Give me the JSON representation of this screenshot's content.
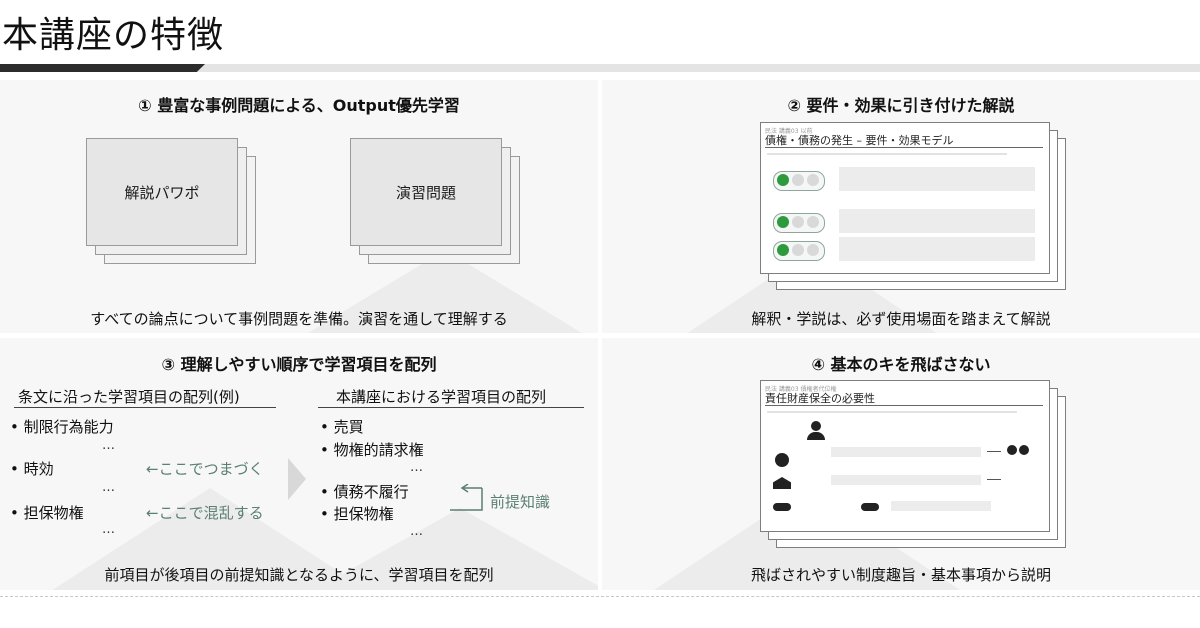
{
  "page": {
    "title": "本講座の特徴"
  },
  "q1": {
    "heading": "① 豊富な事例問題による、Output優先学習",
    "card_left": "解説パワポ",
    "card_right": "演習問題",
    "caption": "すべての論点について事例問題を準備。演習を通して理解する"
  },
  "q2": {
    "heading": "② 要件・効果に引き付けた解説",
    "slide_label": "民法 講義03 以前",
    "slide_title": "債権・債務の発生 – 要件・効果モデル",
    "caption": "解釈・学説は、必ず使用場面を踏まえて解説"
  },
  "q3": {
    "heading": "③ 理解しやすい順序で学習項目を配列",
    "left_head": "条文に沿った学習項目の配列(例)",
    "left_items": [
      "制限行為能力",
      "時効",
      "担保物権"
    ],
    "right_head": "本講座における学習項目の配列",
    "right_items": [
      "売買",
      "物権的請求権",
      "債務不履行",
      "担保物権"
    ],
    "ellipsis": "…",
    "note_connect": "←ここでつまづく",
    "note_confuse": "←ここで混乱する",
    "note_prereq": "前提知識",
    "caption": "前項目が後項目の前提知識となるように、学習項目を配列"
  },
  "q4": {
    "heading": "④ 基本のキを飛ばさない",
    "slide_label": "民法 講義03 債権者代位権",
    "slide_title": "責任財産保全の必要性",
    "caption": "飛ばされやすい制度趣旨・基本事項から説明"
  },
  "colors": {
    "accent_green": "#5a7f73",
    "title_bar_dark": "#2c2c2c",
    "panel_bg": "#f7f7f7",
    "bullet_green": "#2e9a3e"
  }
}
